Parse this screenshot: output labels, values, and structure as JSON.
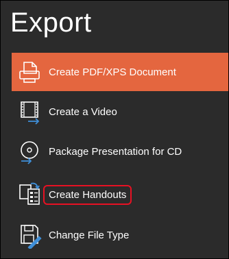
{
  "header": {
    "title": "Export"
  },
  "items": [
    {
      "label": "Create PDF/XPS Document",
      "icon": "pdf-document-icon",
      "selected": true
    },
    {
      "label": "Create a Video",
      "icon": "video-icon"
    },
    {
      "label": "Package Presentation for CD",
      "icon": "cd-package-icon"
    },
    {
      "label": "Create Handouts",
      "icon": "handouts-icon",
      "highlighted": true
    },
    {
      "label": "Change File Type",
      "icon": "change-file-type-icon"
    }
  ],
  "colors": {
    "background": "#2b2b2b",
    "accent": "#e4663f",
    "highlight_border": "#e81123",
    "text": "#ffffff"
  }
}
